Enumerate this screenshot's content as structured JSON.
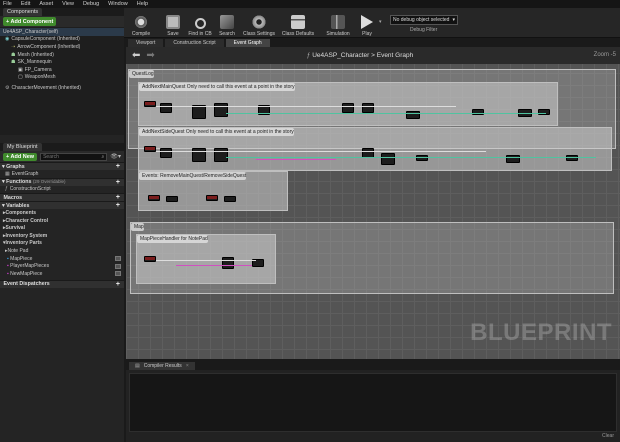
{
  "menu": [
    "File",
    "Edit",
    "Asset",
    "View",
    "Debug",
    "Window",
    "Help"
  ],
  "toolbar": {
    "buttons": [
      {
        "label": "Compile",
        "icon": "compile-icon"
      },
      {
        "label": "Save",
        "icon": "save-icon"
      },
      {
        "label": "Find in CB",
        "icon": "find-in-cb-icon"
      },
      {
        "label": "Search",
        "icon": "search-icon"
      },
      {
        "label": "Class Settings",
        "icon": "class-settings-icon"
      },
      {
        "label": "Class Defaults",
        "icon": "class-defaults-icon"
      },
      {
        "label": "Simulation",
        "icon": "simulation-icon"
      },
      {
        "label": "Play",
        "icon": "play-icon"
      }
    ],
    "debug_select": "No debug object selected",
    "debug_filter": "Debug Filter"
  },
  "components": {
    "tab": "Components",
    "add_button": "+ Add Component",
    "root": "Ue4ASP_Character(self)",
    "items": [
      "CapsuleComponent (Inherited)",
      "ArrowComponent (Inherited)",
      "Mesh (Inherited)",
      "SK_Mannequin",
      "FP_Camera",
      "WeaponMesh",
      "CharacterMovement (Inherited)"
    ]
  },
  "my_blueprint": {
    "tab": "My Blueprint",
    "add_new": "+ Add New",
    "search_placeholder": "Search",
    "graphs_label": "Graphs",
    "event_graph": "EventGraph",
    "functions_label": "Functions",
    "functions_override": "(29 Overridable)",
    "construction_script": "ConstructionScript",
    "macros_label": "Macros",
    "variables_label": "Variables",
    "var_groups": [
      "Components",
      "Character Control",
      "Survival",
      "Inventory System",
      "Inventory Parts"
    ],
    "note_pad": "Note Pad",
    "variables": [
      "MapPiece",
      "PlayerMapPieces",
      "NewMapPiece"
    ],
    "event_dispatchers_label": "Event Dispatchers"
  },
  "tabs": [
    "Viewport",
    "Construction Script",
    "Event Graph"
  ],
  "breadcrumb": {
    "root": "Ue4ASP_Character",
    "sep": ">",
    "current": "Event Graph"
  },
  "zoom": "Zoom -5",
  "watermark": "BLUEPRINT",
  "comments": [
    {
      "title": "QuestLog"
    },
    {
      "title": "AddNextMainQuest   Only need to call this event at a point in the story"
    },
    {
      "title": "AddNextSideQuest   Only need to call this event at a point in the story"
    },
    {
      "title": "Events: RemoveMainQuest/RemoveSideQuest"
    },
    {
      "title": "Map"
    },
    {
      "title": "MapPieceHandler for NotePad"
    }
  ],
  "compiler_results": {
    "tab": "Compiler Results",
    "clear": "Clear"
  },
  "colors": {
    "accent_green": "#3f8a2c",
    "node_red": "#7a1d1d",
    "exec_wire": "#e0e0e0",
    "data_wire": "#4fc3a0",
    "pink_wire": "#d050c0"
  }
}
